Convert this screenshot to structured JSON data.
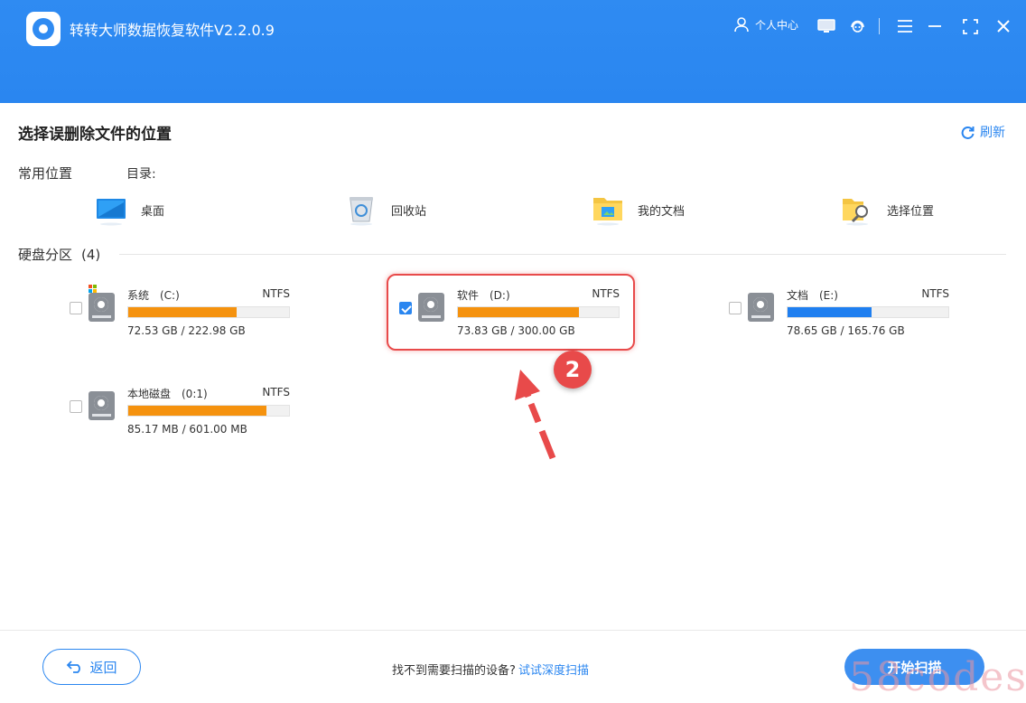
{
  "header": {
    "app_title": "转转大师数据恢复软件V2.2.0.9",
    "user_center": "个人中心",
    "bg_color": "#2f8bf2"
  },
  "main": {
    "page_title": "选择误删除文件的位置",
    "refresh_label": "刷新",
    "common_section_label": "常用位置",
    "directory_label": "目录:",
    "locations": [
      {
        "label": "桌面",
        "icon": "desktop-icon"
      },
      {
        "label": "回收站",
        "icon": "recycle-bin-icon"
      },
      {
        "label": "我的文档",
        "icon": "documents-folder-icon"
      },
      {
        "label": "选择位置",
        "icon": "choose-location-icon"
      }
    ],
    "disk_section_label": "硬盘分区",
    "disk_count": "(4)",
    "drives": [
      {
        "name": "系统　(C:)",
        "fs": "NTFS",
        "size": "72.53 GB / 222.98 GB",
        "used_fraction": 0.675,
        "bar_color": "#f5920e",
        "checked": false
      },
      {
        "name": "软件　(D:)",
        "fs": "NTFS",
        "size": "73.83 GB / 300.00 GB",
        "used_fraction": 0.75,
        "bar_color": "#f5920e",
        "checked": true
      },
      {
        "name": "文档　(E:)",
        "fs": "NTFS",
        "size": "78.65 GB / 165.76 GB",
        "used_fraction": 0.52,
        "bar_color": "#1f7ff0",
        "checked": false
      },
      {
        "name": "本地磁盘　(0:1)",
        "fs": "NTFS",
        "size": "85.17 MB / 601.00 MB",
        "used_fraction": 0.86,
        "bar_color": "#f5920e",
        "checked": false
      }
    ],
    "annotation_step": "2",
    "accent_color": "#2a86f0",
    "highlight_color": "#e84a4a"
  },
  "footer": {
    "back_label": "返回",
    "hint_text": "找不到需要扫描的设备?",
    "deep_scan_label": "试试深度扫描",
    "start_scan_label": "开始扫描",
    "watermark": "58codes"
  }
}
